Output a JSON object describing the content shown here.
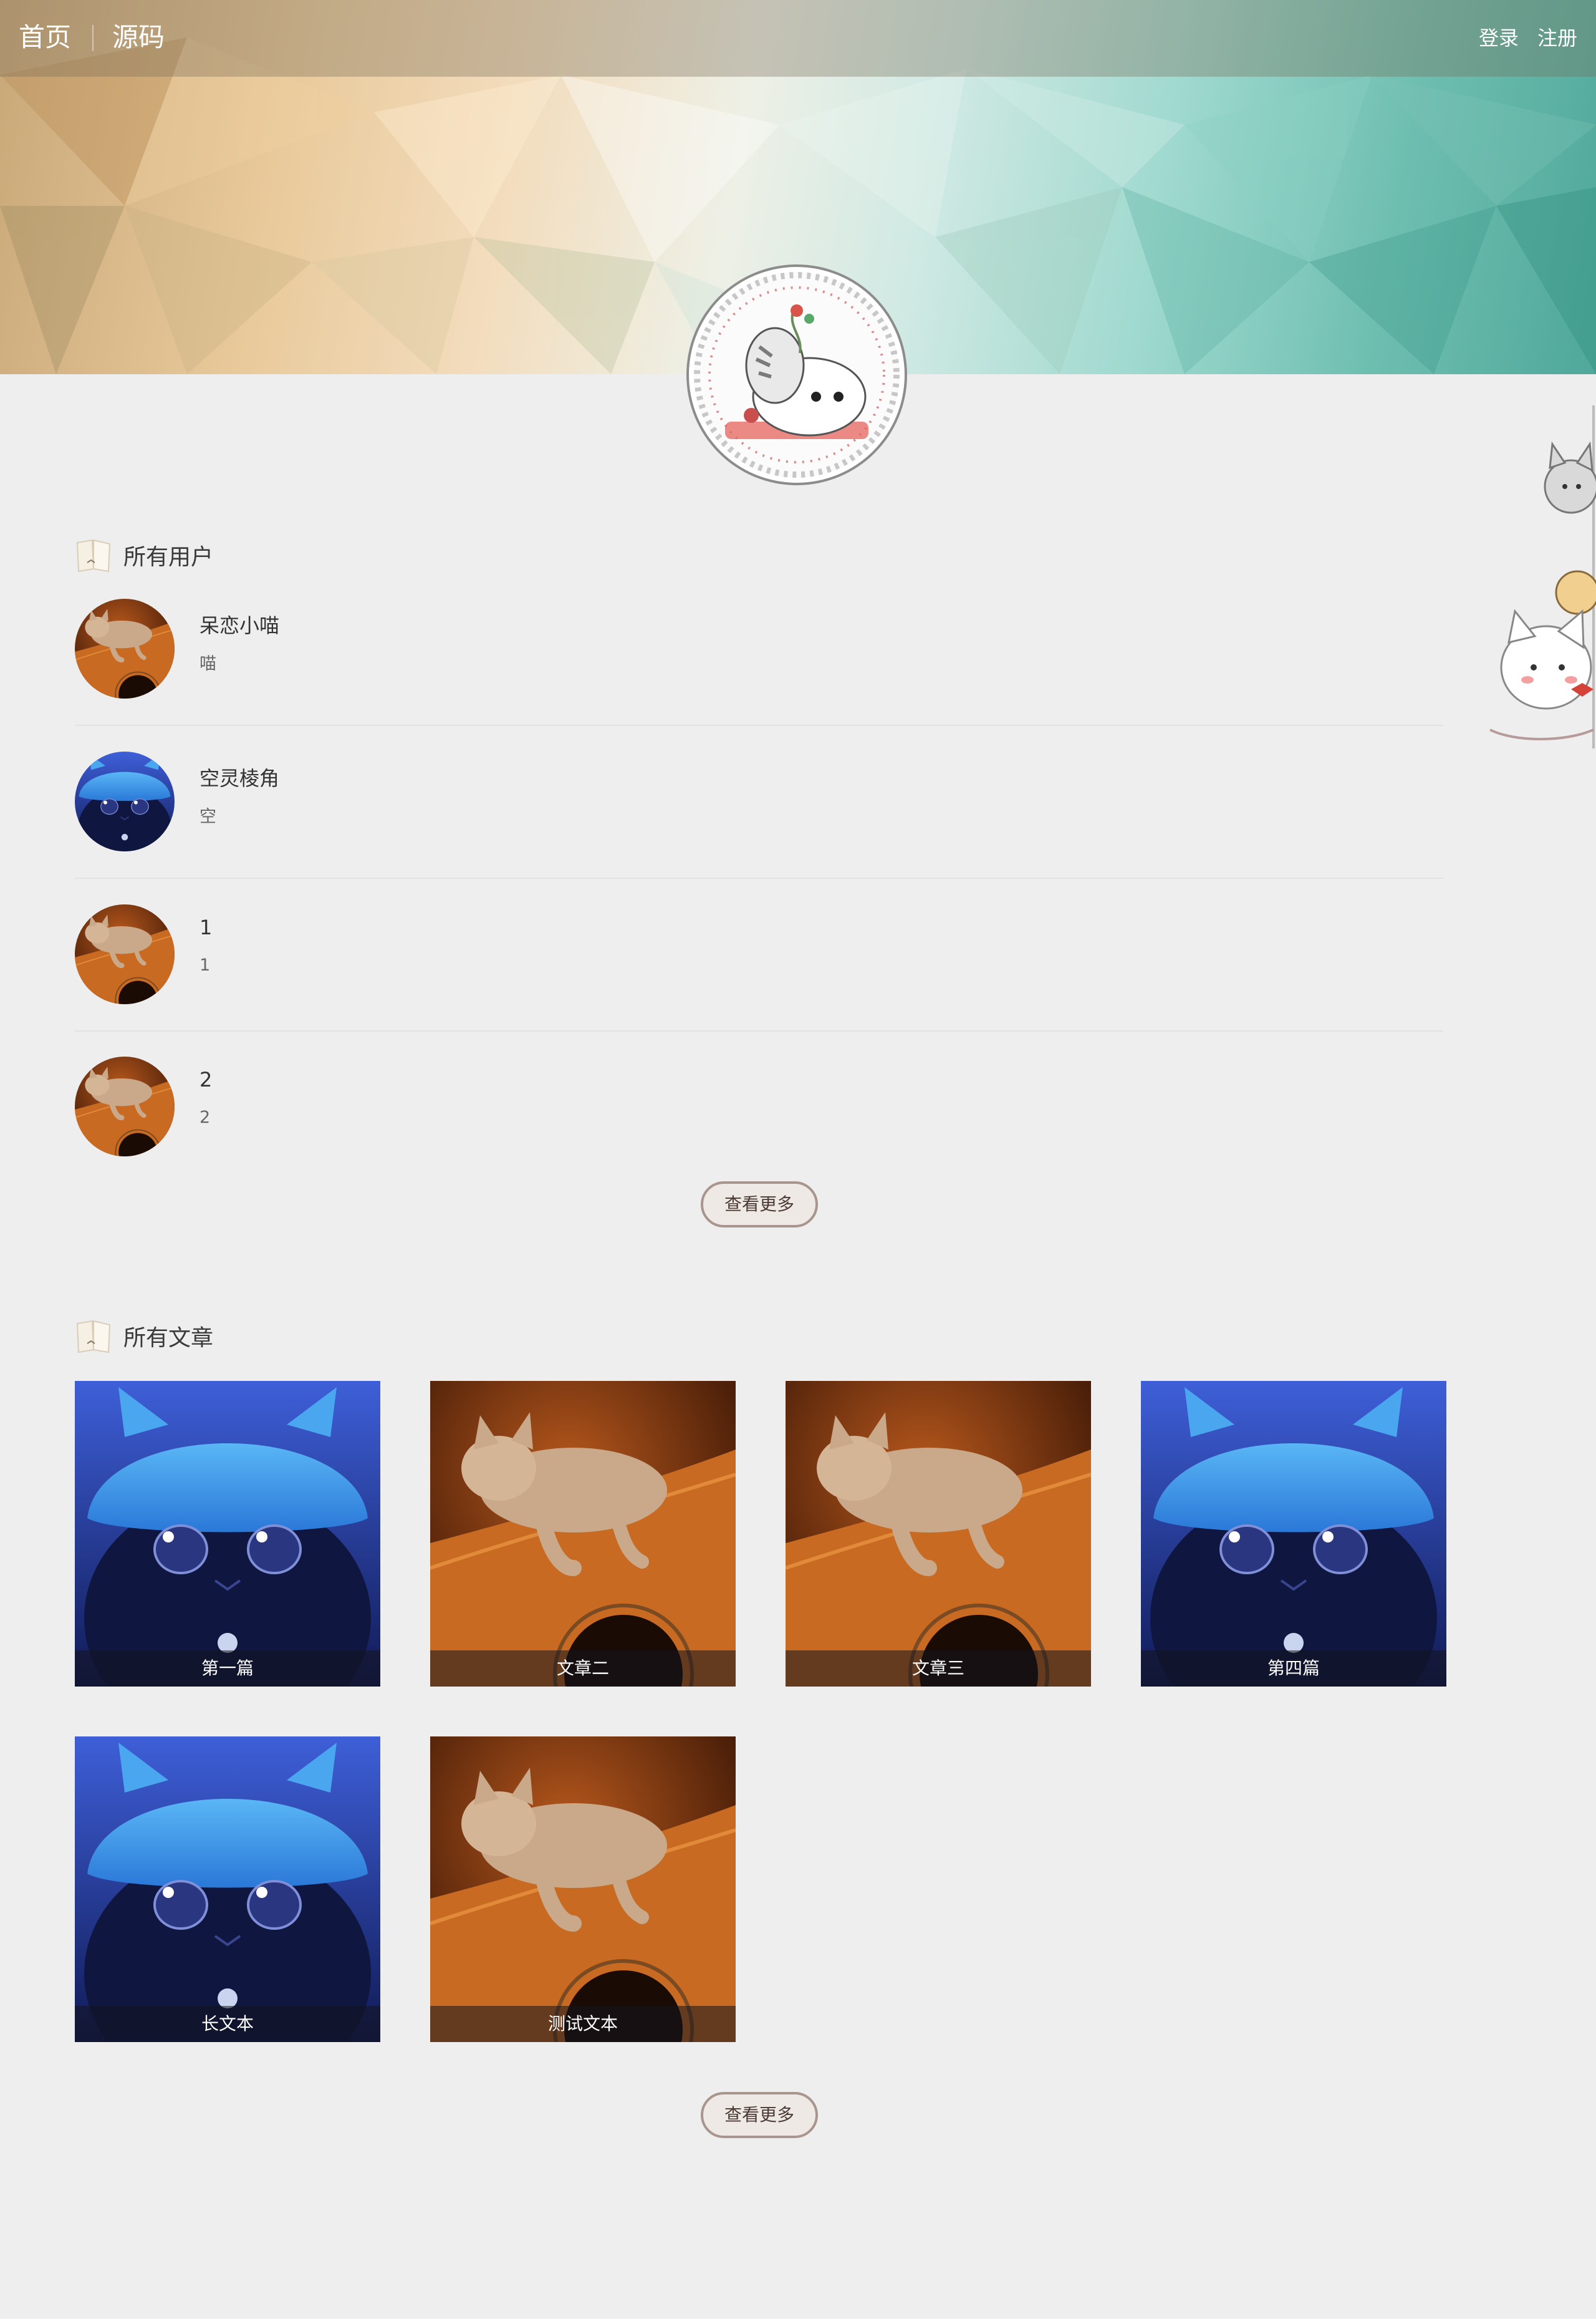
{
  "nav": {
    "home": "首页",
    "source": "源码",
    "login": "登录",
    "register": "注册"
  },
  "users_section": {
    "title": "所有用户",
    "users": [
      {
        "name": "呆恋小喵",
        "desc": "喵",
        "avatar": "kitten-guitar"
      },
      {
        "name": "空灵棱角",
        "desc": "空",
        "avatar": "blue-hat-cat"
      },
      {
        "name": "1",
        "desc": "1",
        "avatar": "kitten-guitar"
      },
      {
        "name": "2",
        "desc": "2",
        "avatar": "kitten-guitar"
      }
    ],
    "more_label": "查看更多"
  },
  "articles_section": {
    "title": "所有文章",
    "articles": [
      {
        "title": "第一篇",
        "cover": "blue-hat-cat"
      },
      {
        "title": "文章二",
        "cover": "kitten-guitar"
      },
      {
        "title": "文章三",
        "cover": "kitten-guitar"
      },
      {
        "title": "第四篇",
        "cover": "blue-hat-cat"
      },
      {
        "title": "长文本",
        "cover": "blue-hat-cat"
      },
      {
        "title": "测试文本",
        "cover": "kitten-guitar"
      }
    ],
    "more_label": "查看更多"
  }
}
